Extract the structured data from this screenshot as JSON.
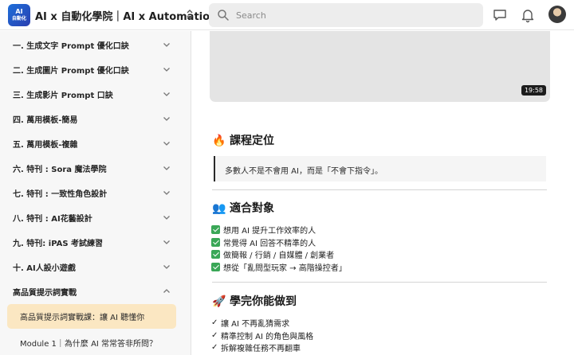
{
  "header": {
    "logo_line1": "AI",
    "logo_line2": "自動化",
    "title": "AI x 自動化學院｜AI x Automation",
    "search_placeholder": "Search"
  },
  "sidebar": {
    "items": [
      {
        "label": "一. 生成文字 Prompt 優化口訣"
      },
      {
        "label": "二. 生成圖片 Prompt 優化口訣"
      },
      {
        "label": "三. 生成影片 Prompt 口訣"
      },
      {
        "label": "四. 萬用模板-簡易"
      },
      {
        "label": "五. 萬用模板-複雜"
      },
      {
        "label": "六. 特刊 : Sora 魔法學院"
      },
      {
        "label": "七. 特刊 : 一致性角色設計"
      },
      {
        "label": "八. 特刊 : AI花藝設計"
      },
      {
        "label": "九. 特刊: iPAS 考試練習"
      },
      {
        "label": "十. AI人設小遊戲"
      },
      {
        "label": "高品質提示詞實戰"
      }
    ],
    "active_lesson": "高品質提示詞實戰課：讓 AI 聽懂你",
    "next_lesson": "Module 1｜為什麼 AI 常常答非所問？"
  },
  "video": {
    "duration": "19:58"
  },
  "sections": {
    "positioning": {
      "emoji": "🔥",
      "title": "課程定位",
      "quote": "多數人不是不會用 AI，而是「不會下指令」。"
    },
    "audience": {
      "emoji": "👥",
      "title": "適合對象",
      "items": [
        "想用 AI 提升工作效率的人",
        "常覺得 AI 回答不精準的人",
        "做簡報 / 行銷 / 自媒體 / 創業者",
        "想從「亂問型玩家 → 高階操控者」"
      ]
    },
    "outcomes": {
      "emoji": "🚀",
      "title": "學完你能做到",
      "items": [
        "讓 AI 不再亂猜需求",
        "精準控制 AI 的角色與風格",
        "拆解複雜任務不再翻車"
      ]
    }
  },
  "colors": {
    "active_bg": "#fbe7c2",
    "check_green": "#3aa757",
    "sidebar_bg": "#f7f7f7"
  }
}
